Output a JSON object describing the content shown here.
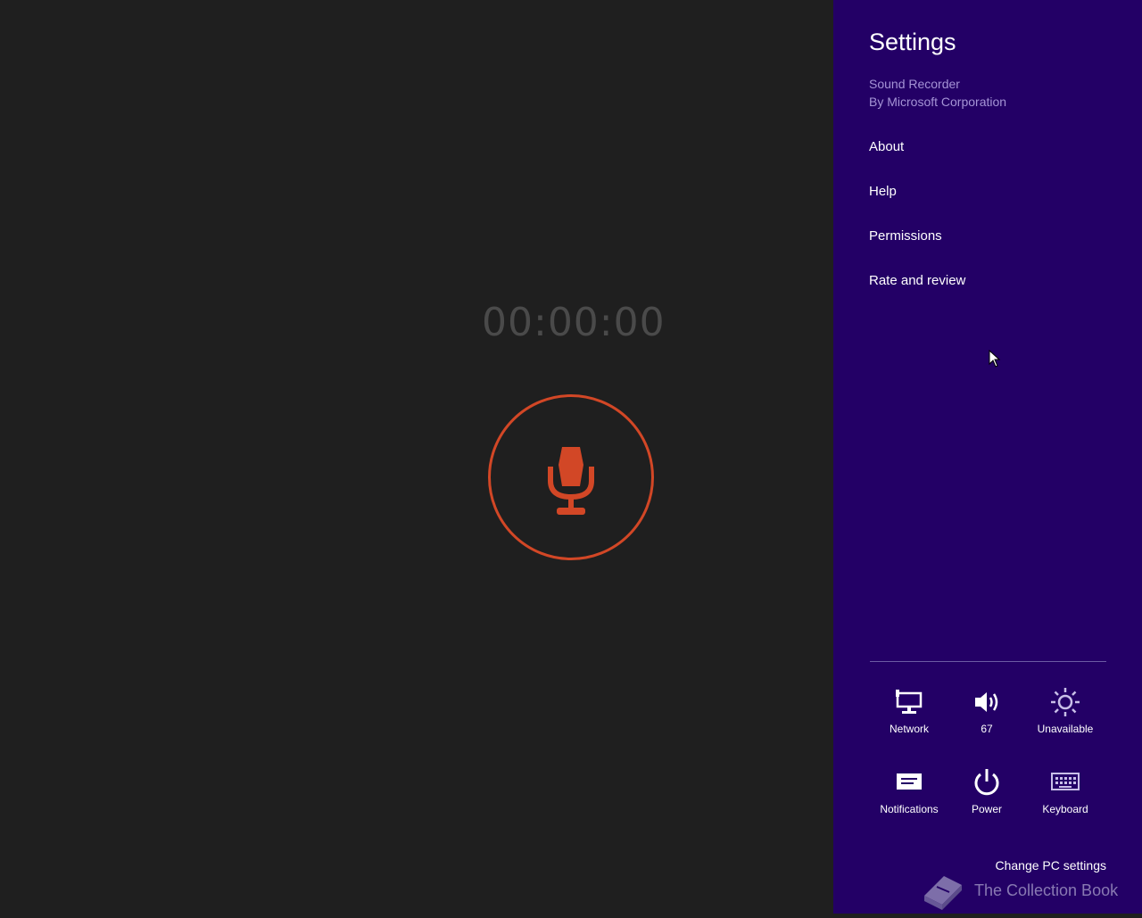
{
  "recorder": {
    "timer": "00:00:00"
  },
  "settings": {
    "title": "Settings",
    "app_name": "Sound Recorder",
    "app_publisher": "By Microsoft Corporation",
    "menu": [
      {
        "label": "About"
      },
      {
        "label": "Help"
      },
      {
        "label": "Permissions"
      },
      {
        "label": "Rate and review"
      }
    ],
    "quick_settings": [
      {
        "label": "Network",
        "icon": "network-icon"
      },
      {
        "label": "67",
        "icon": "volume-icon"
      },
      {
        "label": "Unavailable",
        "icon": "brightness-icon"
      },
      {
        "label": "Notifications",
        "icon": "notifications-icon"
      },
      {
        "label": "Power",
        "icon": "power-icon"
      },
      {
        "label": "Keyboard",
        "icon": "keyboard-icon"
      }
    ],
    "change_pc_settings": "Change PC settings"
  },
  "watermark": {
    "text": "The Collection Book"
  },
  "colors": {
    "accent": "#d24726",
    "charm_bg": "#230066",
    "app_bg": "#1f1f1f"
  }
}
